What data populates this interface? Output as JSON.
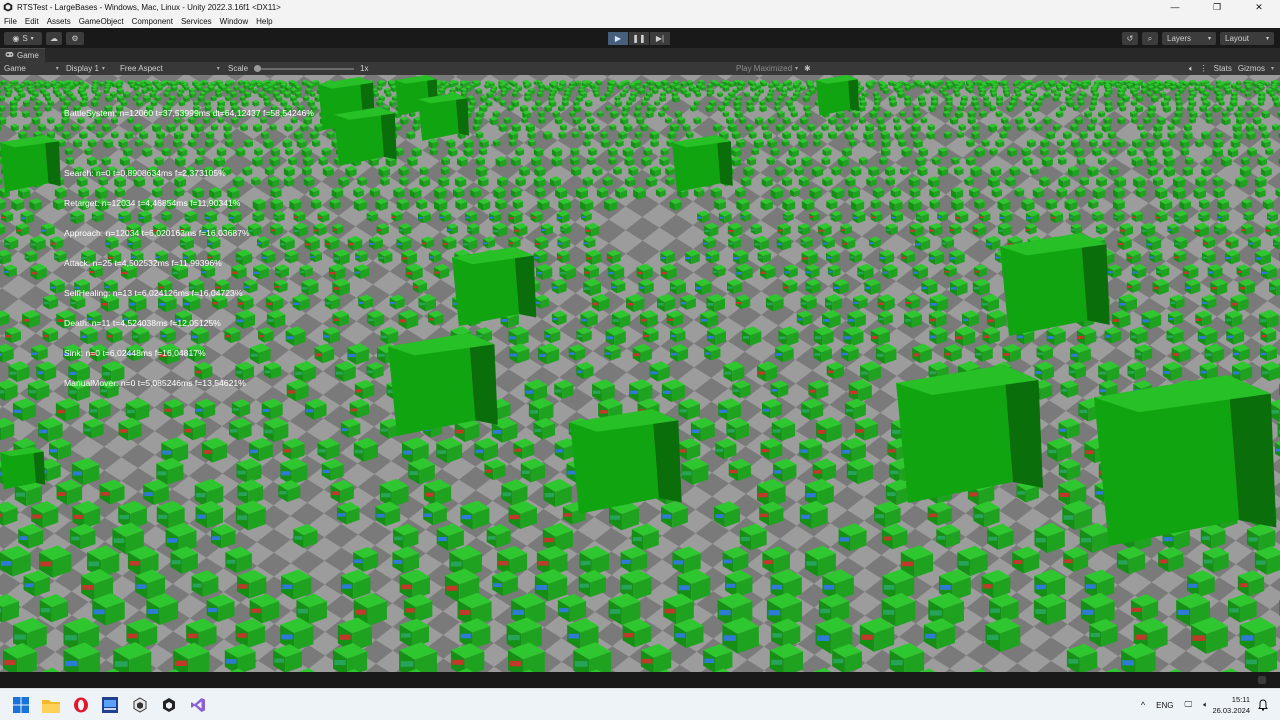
{
  "window": {
    "title": "RTSTest - LargeBases - Windows, Mac, Linux - Unity 2022.3.16f1 <DX11>",
    "minimize": "—",
    "maximize": "❐",
    "close": "✕"
  },
  "menu": [
    "File",
    "Edit",
    "Assets",
    "GameObject",
    "Component",
    "Services",
    "Window",
    "Help"
  ],
  "toolbar": {
    "account_label": "S",
    "layers_label": "Layers",
    "layout_label": "Layout"
  },
  "game_tab": {
    "label": "Game"
  },
  "game_toolbar": {
    "view_mode": "Game",
    "display": "Display 1",
    "aspect": "Free Aspect",
    "scale_label": "Scale",
    "scale_value": "1x",
    "play_mode": "Play Maximized",
    "stats_label": "Stats",
    "gizmos_label": "Gizmos"
  },
  "stats": [
    "BattleSystem: n=12060 t=37,53999ms dt=64,12437 f=58,54246%",
    "Search: n=0 t=0,8908634ms f=2,373105%",
    "Retarget: n=12034 t=4,46854ms f=11,90341%",
    "Approach: n=12034 t=6,020163ms f=16,03687%",
    "Attack: n=25 t=4,502532ms f=11,99396%",
    "SelfHealing: n=13 t=6,024126ms f=16,04723%",
    "Death: n=11 t=4,524038ms f=12,05125%",
    "Sink: n=0 t=6,02448ms f=16,04817%",
    "ManualMover: n=0 t=5,085246ms f=13,54621%"
  ],
  "taskbar": {
    "language": "ENG",
    "time": "15:11",
    "date": "26.03.2024"
  },
  "colors": {
    "unit_green": "#1fa21f",
    "base_green": "#1fbf1f",
    "ground_light": "#9c9c9c",
    "ground_dark": "#7a7a7a"
  }
}
